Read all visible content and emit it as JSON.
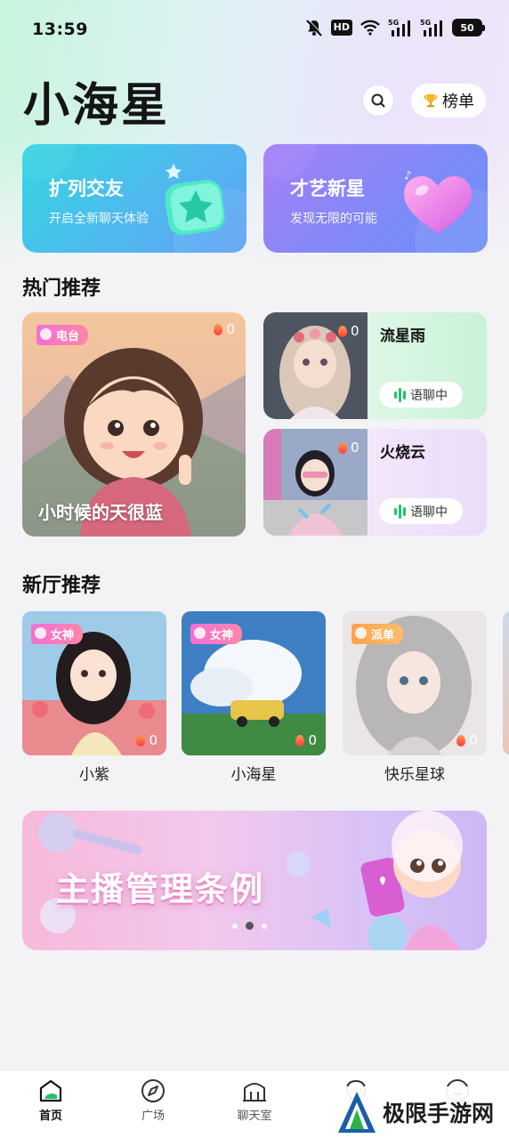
{
  "status_bar": {
    "time": "13:59",
    "network_5g": "5G",
    "hd": "HD",
    "battery": "50"
  },
  "header": {
    "title": "小海星",
    "search_icon": "search-icon",
    "ranking_label": "榜单",
    "ranking_icon": "trophy-icon"
  },
  "features": [
    {
      "title": "扩列交友",
      "subtitle": "开启全新聊天体验",
      "icon": "star-badge-icon",
      "color": "#45c6ea"
    },
    {
      "title": "才艺新星",
      "subtitle": "发现无限的可能",
      "icon": "heart-icon",
      "color": "#8a86f7"
    }
  ],
  "hot": {
    "heading": "热门推荐",
    "featured": {
      "tag": "电台",
      "heat": "0",
      "name": "小时候的天很蓝"
    },
    "items": [
      {
        "name": "流星雨",
        "heat": "0",
        "status": "语聊中"
      },
      {
        "name": "火烧云",
        "heat": "0",
        "status": "语聊中"
      }
    ]
  },
  "new_rooms": {
    "heading": "新厅推荐",
    "items": [
      {
        "name": "小紫",
        "tag": "女神",
        "heat": "0"
      },
      {
        "name": "小海星",
        "tag": "女神",
        "heat": "0"
      },
      {
        "name": "快乐星球",
        "tag": "派单",
        "heat": "0"
      }
    ]
  },
  "banner": {
    "title": "主播管理条例",
    "slides": 3,
    "active_slide": 2
  },
  "tabbar": {
    "items": [
      {
        "label": "首页",
        "icon": "home-icon",
        "active": true
      },
      {
        "label": "广场",
        "icon": "compass-icon",
        "active": false
      },
      {
        "label": "聊天室",
        "icon": "chatroom-icon",
        "active": false
      },
      {
        "label": "",
        "icon": "message-icon",
        "active": false
      },
      {
        "label": "",
        "icon": "profile-icon",
        "active": false
      }
    ]
  },
  "watermark": {
    "text": "极限手游网"
  },
  "colors": {
    "accent_green": "#23c46a",
    "tag_pink": "#f36fd4",
    "background": "#f3f3f5"
  }
}
